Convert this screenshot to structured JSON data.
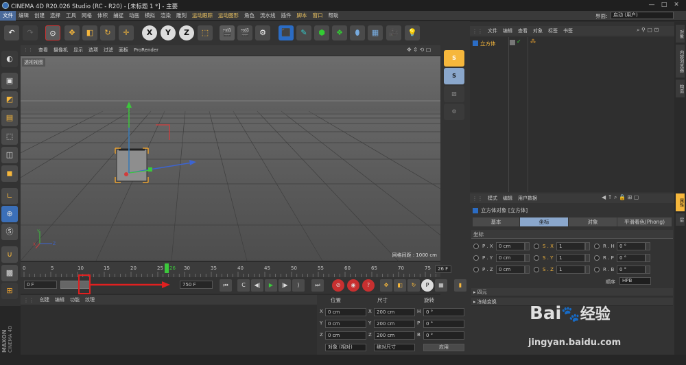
{
  "window": {
    "title": "CINEMA 4D R20.026 Studio (RC - R20) - [未标题 1 *] - 主要",
    "minimize": "—",
    "maximize": "□",
    "close": "✕"
  },
  "menu": {
    "items": [
      "文件",
      "编辑",
      "创建",
      "选择",
      "工具",
      "网格",
      "体积",
      "捕捉",
      "动画",
      "模拟",
      "渲染",
      "雕刻",
      "运动跟踪",
      "运动图形",
      "角色",
      "流水线",
      "插件",
      "脚本",
      "窗口",
      "帮助"
    ],
    "layout_label": "界面:",
    "layout_value": "启动 (用户)"
  },
  "toolbar": {
    "undo": "↶",
    "redo": "↷",
    "x": "X",
    "y": "Y",
    "z": "Z"
  },
  "viewport": {
    "menu": [
      "查看",
      "摄像机",
      "显示",
      "选项",
      "过滤",
      "面板",
      "ProRender"
    ],
    "label": "透视视图",
    "grid_spacing": "网格间距 : 1000 cm"
  },
  "timeline": {
    "ticks": [
      "0",
      "5",
      "10",
      "15",
      "20",
      "25",
      "30",
      "35",
      "40",
      "45",
      "50",
      "55",
      "60",
      "65",
      "70",
      "75"
    ],
    "current_frame": "26",
    "end_frame_box": "26 F"
  },
  "transport": {
    "start": "0 F",
    "end": "750 F"
  },
  "material": {
    "menu": [
      "创建",
      "编辑",
      "功能",
      "纹理"
    ]
  },
  "coords": {
    "headers": [
      "位置",
      "尺寸",
      "旋转"
    ],
    "rows": [
      {
        "a": "X",
        "p": "0 cm",
        "b": "X",
        "s": "200 cm",
        "c": "H",
        "r": "0 °"
      },
      {
        "a": "Y",
        "p": "0 cm",
        "b": "Y",
        "s": "200 cm",
        "c": "P",
        "r": "0 °"
      },
      {
        "a": "Z",
        "p": "0 cm",
        "b": "Z",
        "s": "200 cm",
        "c": "B",
        "r": "0 °"
      }
    ],
    "mode": "对象 (相对)",
    "size_mode": "绝对尺寸",
    "apply": "应用"
  },
  "object_manager": {
    "menu": [
      "文件",
      "编辑",
      "查看",
      "对象",
      "标签",
      "书签"
    ],
    "object_name": "立方体"
  },
  "attributes": {
    "menu": [
      "模式",
      "编辑",
      "用户数据"
    ],
    "title": "立方体对象 [立方体]",
    "tabs": [
      "基本",
      "坐标",
      "对象",
      "平滑着色(Phong)"
    ],
    "section": "坐标",
    "rows": [
      {
        "pl": "P . X",
        "pv": "0 cm",
        "sl": "S . X",
        "sv": "1",
        "rl": "R . H",
        "rv": "0 °"
      },
      {
        "pl": "P . Y",
        "pv": "0 cm",
        "sl": "S . Y",
        "sv": "1",
        "rl": "R . P",
        "rv": "0 °"
      },
      {
        "pl": "P . Z",
        "pv": "0 cm",
        "sl": "S . Z",
        "sv": "1",
        "rl": "R . B",
        "rv": "0 °"
      }
    ],
    "order_label": "顺序",
    "order_value": "HPB",
    "groups": [
      "四元",
      "冻结变换"
    ]
  },
  "right_tabs": [
    "对象",
    "内容浏览器",
    "构造",
    "属性",
    "层"
  ],
  "brand": {
    "line1": "MAXON",
    "line2": "CINEMA 4D"
  },
  "watermark": {
    "site": "jingyan.baidu.com",
    "brand": "Bai",
    "brand2": "经验"
  },
  "colors": {
    "accent": "#4a6a9a",
    "axis_x": "#d23c3c",
    "axis_y": "#3cc83c",
    "axis_z": "#3c64d2",
    "selection": "#e8a030",
    "annotation": "#e02020"
  }
}
